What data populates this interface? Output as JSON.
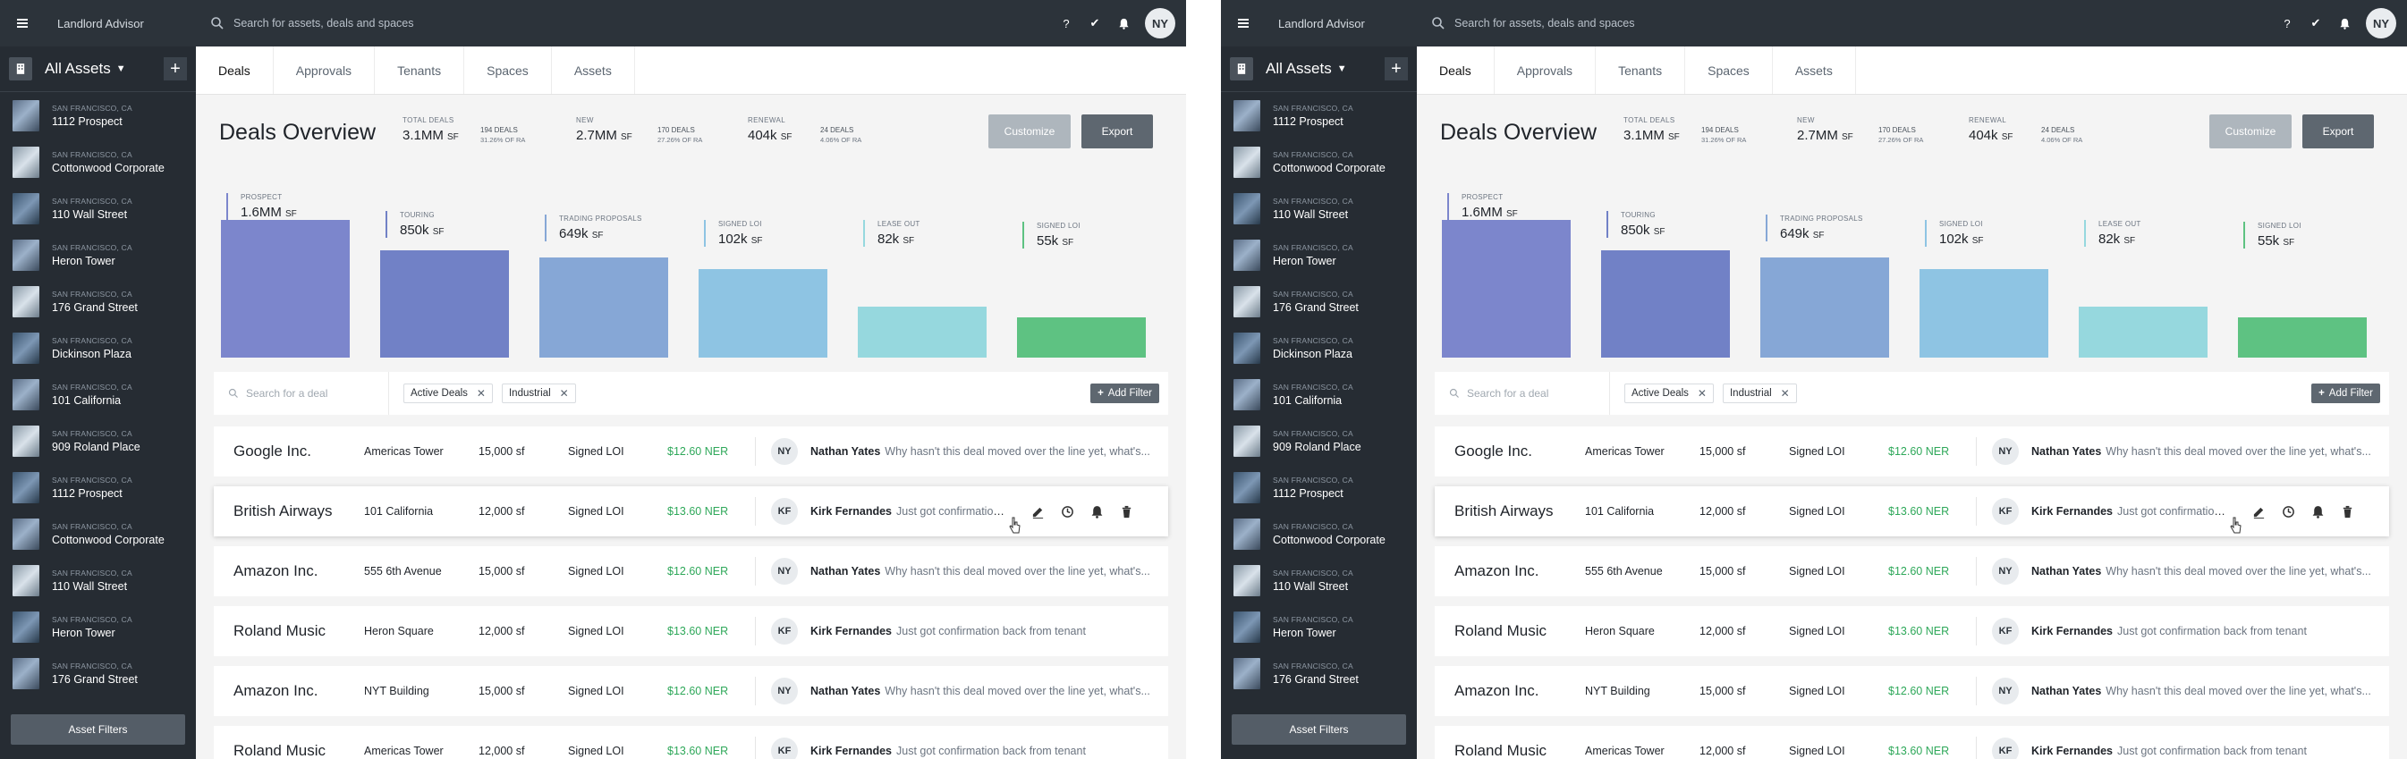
{
  "app": {
    "brand": "Landlord Advisor",
    "search_placeholder": "Search for assets, deals and spaces",
    "user_initials": "NY"
  },
  "sidebar": {
    "title": "All Assets",
    "assets": [
      {
        "city": "SAN FRANCISCO, CA",
        "name": "1112 Prospect"
      },
      {
        "city": "SAN FRANCISCO, CA",
        "name": "Cottonwood Corporate"
      },
      {
        "city": "SAN FRANCISCO, CA",
        "name": "110 Wall Street"
      },
      {
        "city": "SAN FRANCISCO, CA",
        "name": "Heron Tower"
      },
      {
        "city": "SAN FRANCISCO, CA",
        "name": "176 Grand Street"
      },
      {
        "city": "SAN FRANCISCO, CA",
        "name": "Dickinson Plaza"
      },
      {
        "city": "SAN FRANCISCO, CA",
        "name": "101 California"
      },
      {
        "city": "SAN FRANCISCO, CA",
        "name": "909 Roland Place"
      },
      {
        "city": "SAN FRANCISCO, CA",
        "name": "1112 Prospect"
      },
      {
        "city": "SAN FRANCISCO, CA",
        "name": "Cottonwood Corporate"
      },
      {
        "city": "SAN FRANCISCO, CA",
        "name": "110 Wall Street"
      },
      {
        "city": "SAN FRANCISCO, CA",
        "name": "Heron Tower"
      },
      {
        "city": "SAN FRANCISCO, CA",
        "name": "176 Grand Street"
      }
    ],
    "filters_button": "Asset Filters"
  },
  "tabs": [
    "Deals",
    "Approvals",
    "Tenants",
    "Spaces",
    "Assets"
  ],
  "overview": {
    "title": "Deals Overview",
    "total": {
      "label": "TOTAL DEALS",
      "value": "3.1MM",
      "unit": "SF",
      "deals": "194 DEALS",
      "pct": "31.26% OF RA"
    },
    "new": {
      "label": "NEW",
      "value": "2.7MM",
      "unit": "SF",
      "deals": "170 DEALS",
      "pct": "27.26% OF RA"
    },
    "renewal": {
      "label": "RENEWAL",
      "value": "404k",
      "unit": "SF",
      "deals": "24 DEALS",
      "pct": "4.06% OF RA"
    },
    "customize": "Customize",
    "export": "Export"
  },
  "funnel": [
    {
      "label": "PROSPECT",
      "value": "1.6MM",
      "unit": "SF",
      "fill": 1.0,
      "color": "#7c86cc"
    },
    {
      "label": "TOURING",
      "value": "850k",
      "unit": "SF",
      "fill": 0.78,
      "color": "#7181c6"
    },
    {
      "label": "TRADING PROPOSALS",
      "value": "649k",
      "unit": "SF",
      "fill": 0.73,
      "color": "#86a7d6"
    },
    {
      "label": "SIGNED LOI",
      "value": "102k",
      "unit": "SF",
      "fill": 0.64,
      "color": "#8ec4e3"
    },
    {
      "label": "LEASE OUT",
      "value": "82k",
      "unit": "SF",
      "fill": 0.37,
      "color": "#96d8de"
    },
    {
      "label": "SIGNED LOI",
      "value": "55k",
      "unit": "SF",
      "fill": 0.29,
      "color": "#5ec282"
    }
  ],
  "filters": {
    "search_placeholder": "Search for a deal",
    "chips": [
      "Active Deals",
      "Industrial"
    ],
    "add": "Add Filter"
  },
  "deals": [
    {
      "company": "Google Inc.",
      "property": "Americas Tower",
      "size": "15,000 sf",
      "status": "Signed LOI",
      "ner": "$12.60 NER",
      "initials": "NY",
      "who": "Nathan Yates",
      "msg": "Why hasn't this deal moved over the line yet, what's..."
    },
    {
      "company": "British Airways",
      "property": "101 California",
      "size": "12,000 sf",
      "status": "Signed LOI",
      "ner": "$13.60 NER",
      "initials": "KF",
      "who": "Kirk Fernandes",
      "msg": "Just got confirmation..."
    },
    {
      "company": "Amazon Inc.",
      "property": "555 6th Avenue",
      "size": "15,000 sf",
      "status": "Signed LOI",
      "ner": "$12.60 NER",
      "initials": "NY",
      "who": "Nathan Yates",
      "msg": "Why hasn't this deal moved over the line yet, what's..."
    },
    {
      "company": "Roland Music",
      "property": "Heron Square",
      "size": "12,000 sf",
      "status": "Signed LOI",
      "ner": "$13.60 NER",
      "initials": "KF",
      "who": "Kirk Fernandes",
      "msg": "Just got confirmation back from tenant"
    },
    {
      "company": "Amazon Inc.",
      "property": "NYT Building",
      "size": "15,000 sf",
      "status": "Signed LOI",
      "ner": "$12.60 NER",
      "initials": "NY",
      "who": "Nathan Yates",
      "msg": "Why hasn't this deal moved over the line yet, what's..."
    },
    {
      "company": "Roland Music",
      "property": "Americas Tower",
      "size": "12,000 sf",
      "status": "Signed LOI",
      "ner": "$13.60 NER",
      "initials": "KF",
      "who": "Kirk Fernandes",
      "msg": "Just got confirmation back from tenant"
    }
  ]
}
